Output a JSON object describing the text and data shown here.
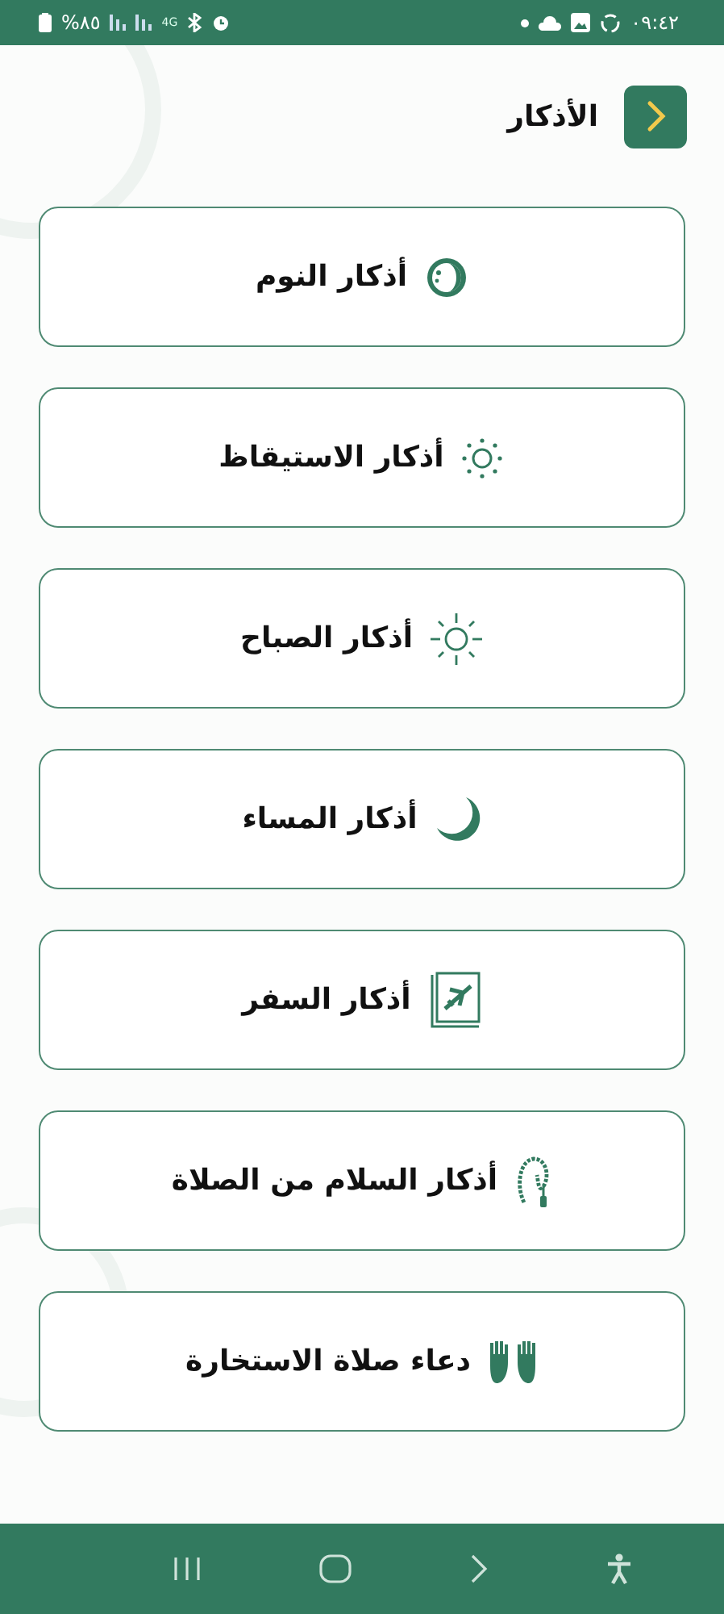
{
  "status_bar": {
    "battery": "%٨٥",
    "network": "4G",
    "time": "٠٩:٤٢"
  },
  "header": {
    "title": "الأذكار"
  },
  "items": [
    {
      "label": "أذكار النوم",
      "kind": "moon-face"
    },
    {
      "label": "أذكار الاستيقاظ",
      "kind": "sun-dots"
    },
    {
      "label": "أذكار الصباح",
      "kind": "sun-rays"
    },
    {
      "label": "أذكار المساء",
      "kind": "crescent"
    },
    {
      "label": "أذكار السفر",
      "kind": "travel-book"
    },
    {
      "label": "أذكار السلام من الصلاة",
      "kind": "beads"
    },
    {
      "label": "دعاء صلاة الاستخارة",
      "kind": "hands"
    }
  ]
}
